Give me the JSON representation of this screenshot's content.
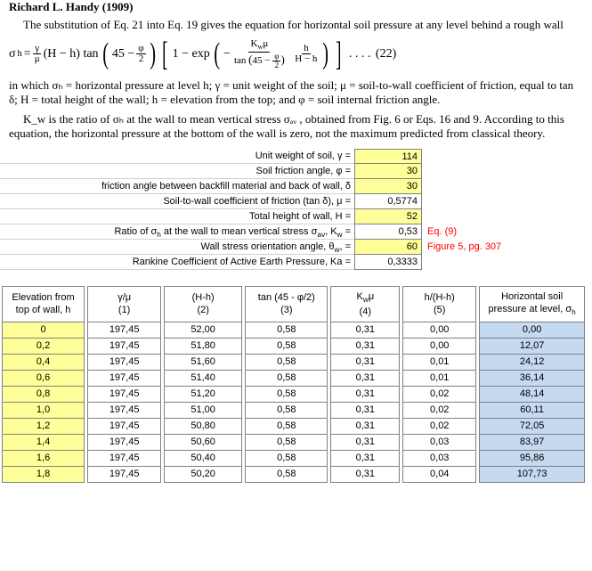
{
  "header_truncated": "Richard L. Handy (1909)",
  "intro": "The substitution of Eq. 21 into Eq. 19 gives the equation for horizontal soil pressure at any level behind a rough wall",
  "equation_number": "(22)",
  "explain1": "in which σₕ = horizontal pressure at level h; γ = unit weight of the soil; μ = soil-to-wall coefficient of friction, equal to tan δ; H = total height of the wall; h = elevation from the top; and φ = soil internal friction angle.",
  "explain2": "K_w is the ratio of σₕ at the wall to mean vertical stress σₐᵥ , obtained from Fig. 6 or Eqs. 16 and 9. According to this equation, the horizontal pressure at the bottom of the wall is zero, not the maximum predicted from classical theory.",
  "params": [
    {
      "label": "Unit weight of soil, γ =",
      "value": "114",
      "cls": "first"
    },
    {
      "label": "Soil friction angle, φ =",
      "value": "30"
    },
    {
      "label": "friction angle between backfill material and back of wall, δ",
      "value": "30"
    },
    {
      "label": "Soil-to-wall coefficient of friction (tan δ), μ =",
      "value": "0,5774",
      "calc": true
    },
    {
      "label": "Total height of wall, H =",
      "value": "52"
    },
    {
      "label": "Ratio of σₕ at the wall to mean vertical stress σₐᵥ, K_w =",
      "value": "0,53",
      "note": "Eq. (9)",
      "calc": true
    },
    {
      "label": "Wall stress orientation angle, θ_w, =",
      "value": "60",
      "note": "Figure 5, pg. 307"
    },
    {
      "label": "Rankine Coefficient of Active Earth Pressure, Ka =",
      "value": "0,3333",
      "calc": true
    }
  ],
  "columns": [
    {
      "h1": "Elevation from top of wall, h",
      "h2": ""
    },
    {
      "h1": "γ/μ",
      "h2": "(1)"
    },
    {
      "h1": "(H-h)",
      "h2": "(2)"
    },
    {
      "h1": "tan (45 - φ/2)",
      "h2": "(3)"
    },
    {
      "h1": "K_wμ",
      "h2": "(4)"
    },
    {
      "h1": "h/(H-h)",
      "h2": "(5)"
    },
    {
      "h1": "Horizontal soil pressure at level, σₕ",
      "h2": ""
    }
  ],
  "chart_data": {
    "type": "table",
    "columns": [
      "h",
      "gamma_over_mu",
      "H_minus_h",
      "tan_term",
      "Kw_mu",
      "h_over_H_minus_h",
      "sigma_h"
    ],
    "rows": [
      [
        "0",
        "197,45",
        "52,00",
        "0,58",
        "0,31",
        "0,00",
        "0,00"
      ],
      [
        "0,2",
        "197,45",
        "51,80",
        "0,58",
        "0,31",
        "0,00",
        "12,07"
      ],
      [
        "0,4",
        "197,45",
        "51,60",
        "0,58",
        "0,31",
        "0,01",
        "24,12"
      ],
      [
        "0,6",
        "197,45",
        "51,40",
        "0,58",
        "0,31",
        "0,01",
        "36,14"
      ],
      [
        "0,8",
        "197,45",
        "51,20",
        "0,58",
        "0,31",
        "0,02",
        "48,14"
      ],
      [
        "1,0",
        "197,45",
        "51,00",
        "0,58",
        "0,31",
        "0,02",
        "60,11"
      ],
      [
        "1,2",
        "197,45",
        "50,80",
        "0,58",
        "0,31",
        "0,02",
        "72,05"
      ],
      [
        "1,4",
        "197,45",
        "50,60",
        "0,58",
        "0,31",
        "0,03",
        "83,97"
      ],
      [
        "1,6",
        "197,45",
        "50,40",
        "0,58",
        "0,31",
        "0,03",
        "95,86"
      ],
      [
        "1,8",
        "197,45",
        "50,20",
        "0,58",
        "0,31",
        "0,04",
        "107,73"
      ]
    ]
  }
}
